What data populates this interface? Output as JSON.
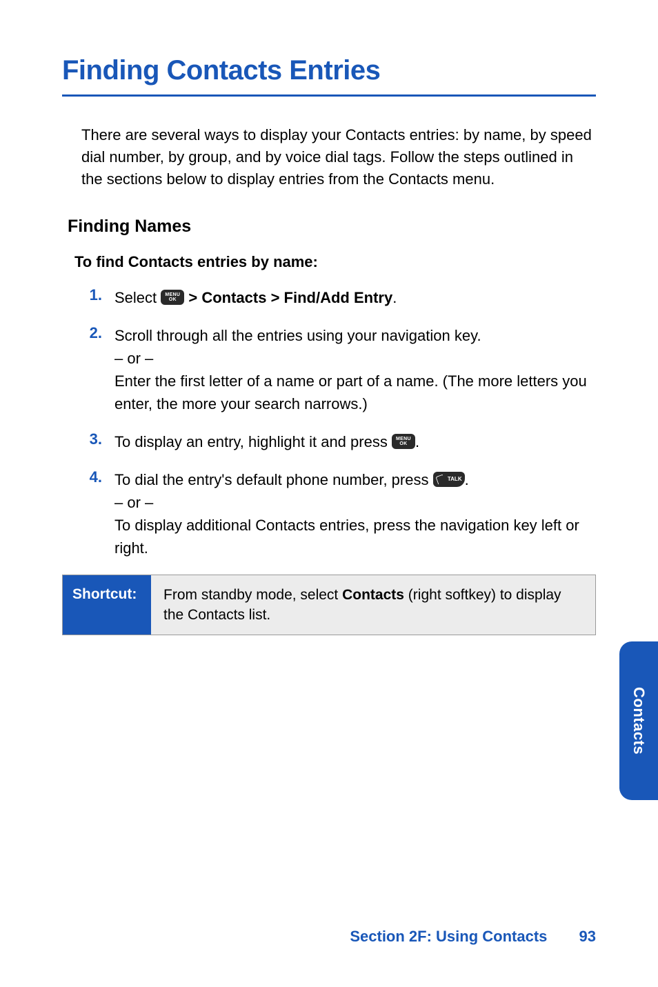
{
  "title": "Finding Contacts Entries",
  "intro": "There are several ways to display your Contacts entries: by name, by speed dial number, by group, and by voice dial tags. Follow the steps outlined in the sections below to display entries from the Contacts menu.",
  "subheading": "Finding Names",
  "sub_instruction": "To find Contacts entries by name:",
  "icons": {
    "menu": {
      "name": "menu-ok",
      "line1": "MENU",
      "line2": "OK"
    },
    "talk": {
      "name": "talk",
      "label": "TALK"
    }
  },
  "steps": [
    {
      "n": "1.",
      "pre": "Select ",
      "icon": "menu",
      "post_bold": " > Contacts > Find/Add Entry",
      "tail": "."
    },
    {
      "n": "2.",
      "line1": "Scroll through all the entries using your navigation key.",
      "or": "– or –",
      "line2": "Enter the first letter of a name or part of a name. (The more letters you enter, the more your search narrows.)"
    },
    {
      "n": "3.",
      "pre": "To display an entry, highlight it and press ",
      "icon": "menu",
      "tail": "."
    },
    {
      "n": "4.",
      "pre": "To dial the entry's default phone number, press ",
      "icon": "talk",
      "tail": ".",
      "or": "– or –",
      "line2": "To display additional Contacts entries, press the navigation key left or right."
    }
  ],
  "shortcut": {
    "label": "Shortcut:",
    "pre": "From standby mode, select ",
    "bold": "Contacts",
    "post": " (right softkey) to display the Contacts list."
  },
  "side_tab": "Contacts",
  "footer": {
    "section": "Section 2F: Using Contacts",
    "page": "93"
  }
}
